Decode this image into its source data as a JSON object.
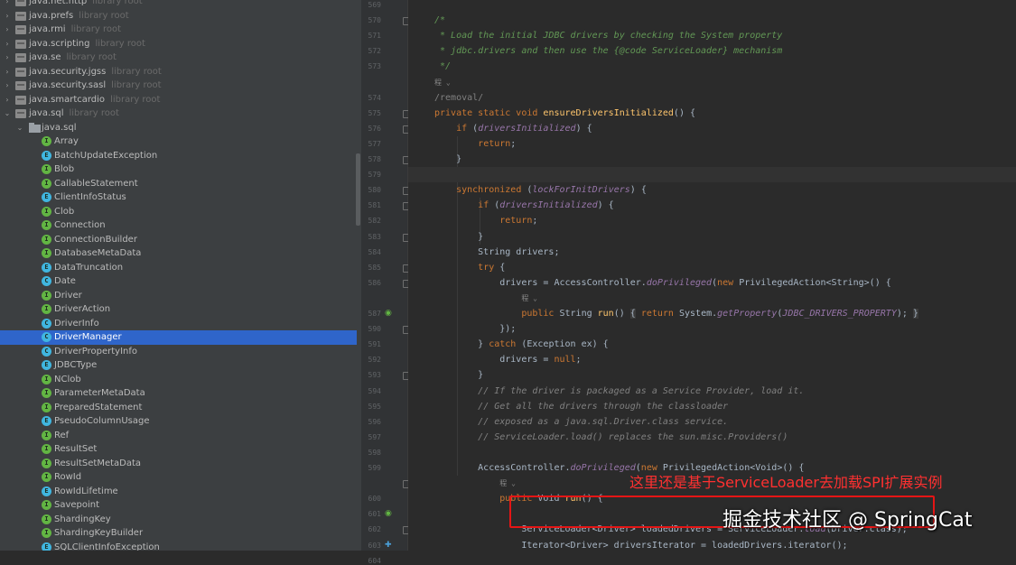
{
  "tree": {
    "items": [
      {
        "label": "java.net.http",
        "root": "library root",
        "kind": "jar"
      },
      {
        "label": "java.prefs",
        "root": "library root",
        "kind": "jar"
      },
      {
        "label": "java.rmi",
        "root": "library root",
        "kind": "jar"
      },
      {
        "label": "java.scripting",
        "root": "library root",
        "kind": "jar"
      },
      {
        "label": "java.se",
        "root": "library root",
        "kind": "jar"
      },
      {
        "label": "java.security.jgss",
        "root": "library root",
        "kind": "jar"
      },
      {
        "label": "java.security.sasl",
        "root": "library root",
        "kind": "jar"
      },
      {
        "label": "java.smartcardio",
        "root": "library root",
        "kind": "jar"
      },
      {
        "label": "java.sql",
        "root": "library root",
        "kind": "jar-open"
      },
      {
        "label": "java.sql",
        "root": "",
        "kind": "package"
      },
      {
        "label": "Array",
        "root": "",
        "kind": "I"
      },
      {
        "label": "BatchUpdateException",
        "root": "",
        "kind": "E"
      },
      {
        "label": "Blob",
        "root": "",
        "kind": "I"
      },
      {
        "label": "CallableStatement",
        "root": "",
        "kind": "I"
      },
      {
        "label": "ClientInfoStatus",
        "root": "",
        "kind": "E"
      },
      {
        "label": "Clob",
        "root": "",
        "kind": "I"
      },
      {
        "label": "Connection",
        "root": "",
        "kind": "I"
      },
      {
        "label": "ConnectionBuilder",
        "root": "",
        "kind": "I"
      },
      {
        "label": "DatabaseMetaData",
        "root": "",
        "kind": "I"
      },
      {
        "label": "DataTruncation",
        "root": "",
        "kind": "E"
      },
      {
        "label": "Date",
        "root": "",
        "kind": "C"
      },
      {
        "label": "Driver",
        "root": "",
        "kind": "I"
      },
      {
        "label": "DriverAction",
        "root": "",
        "kind": "I"
      },
      {
        "label": "DriverInfo",
        "root": "",
        "kind": "C"
      },
      {
        "label": "DriverManager",
        "root": "",
        "kind": "C",
        "selected": true
      },
      {
        "label": "DriverPropertyInfo",
        "root": "",
        "kind": "C"
      },
      {
        "label": "JDBCType",
        "root": "",
        "kind": "E"
      },
      {
        "label": "NClob",
        "root": "",
        "kind": "I"
      },
      {
        "label": "ParameterMetaData",
        "root": "",
        "kind": "I"
      },
      {
        "label": "PreparedStatement",
        "root": "",
        "kind": "I"
      },
      {
        "label": "PseudoColumnUsage",
        "root": "",
        "kind": "E"
      },
      {
        "label": "Ref",
        "root": "",
        "kind": "I"
      },
      {
        "label": "ResultSet",
        "root": "",
        "kind": "I"
      },
      {
        "label": "ResultSetMetaData",
        "root": "",
        "kind": "I"
      },
      {
        "label": "RowId",
        "root": "",
        "kind": "I"
      },
      {
        "label": "RowIdLifetime",
        "root": "",
        "kind": "E"
      },
      {
        "label": "Savepoint",
        "root": "",
        "kind": "I"
      },
      {
        "label": "ShardingKey",
        "root": "",
        "kind": "I"
      },
      {
        "label": "ShardingKeyBuilder",
        "root": "",
        "kind": "I"
      },
      {
        "label": "SQLClientInfoException",
        "root": "",
        "kind": "E"
      }
    ]
  },
  "editor": {
    "lines": [
      {
        "no": "569",
        "segs": []
      },
      {
        "no": "570",
        "segs": [
          [
            "cm",
            "/*"
          ]
        ]
      },
      {
        "no": "571",
        "segs": [
          [
            "cm",
            " * Load the initial JDBC drivers by checking the System property"
          ]
        ]
      },
      {
        "no": "572",
        "segs": [
          [
            "cm",
            " * jdbc.drivers and then use the {@code ServiceLoader} mechanism"
          ]
        ]
      },
      {
        "no": "573",
        "segs": [
          [
            "cm",
            " */"
          ]
        ]
      },
      {
        "no": "",
        "segs": [
          [
            "small",
            "程 ⌄"
          ]
        ]
      },
      {
        "no": "574",
        "segs": [
          [
            "gray",
            "/removal/"
          ]
        ]
      },
      {
        "no": "575",
        "segs": [
          [
            "kw",
            "private static void "
          ],
          [
            "fn",
            "ensureDriversInitialized"
          ],
          [
            "",
            "() {"
          ]
        ]
      },
      {
        "no": "576",
        "segs": [
          [
            "",
            "    "
          ],
          [
            "kw",
            "if "
          ],
          [
            "",
            "("
          ],
          [
            "it",
            "driversInitialized"
          ],
          [
            "",
            ") {"
          ]
        ]
      },
      {
        "no": "577",
        "segs": [
          [
            "",
            "        "
          ],
          [
            "kw",
            "return"
          ],
          [
            "",
            ";"
          ]
        ]
      },
      {
        "no": "578",
        "segs": [
          [
            "",
            "    }"
          ]
        ]
      },
      {
        "no": "579",
        "segs": [],
        "current": true
      },
      {
        "no": "580",
        "segs": [
          [
            "",
            "    "
          ],
          [
            "kw",
            "synchronized "
          ],
          [
            "",
            "("
          ],
          [
            "it",
            "lockForInitDrivers"
          ],
          [
            "",
            ") {"
          ]
        ]
      },
      {
        "no": "581",
        "segs": [
          [
            "",
            "        "
          ],
          [
            "kw",
            "if "
          ],
          [
            "",
            "("
          ],
          [
            "it",
            "driversInitialized"
          ],
          [
            "",
            ") {"
          ]
        ]
      },
      {
        "no": "582",
        "segs": [
          [
            "",
            "            "
          ],
          [
            "kw",
            "return"
          ],
          [
            "",
            ";"
          ]
        ]
      },
      {
        "no": "583",
        "segs": [
          [
            "",
            "        }"
          ]
        ]
      },
      {
        "no": "584",
        "segs": [
          [
            "",
            "        String drivers;"
          ]
        ]
      },
      {
        "no": "585",
        "segs": [
          [
            "",
            "        "
          ],
          [
            "kw",
            "try "
          ],
          [
            "",
            "{"
          ]
        ]
      },
      {
        "no": "586",
        "segs": [
          [
            "",
            "            drivers = AccessController."
          ],
          [
            "it",
            "doPrivileged"
          ],
          [
            "",
            "("
          ],
          [
            "kw",
            "new "
          ],
          [
            "",
            "PrivilegedAction<String>() {"
          ]
        ]
      },
      {
        "no": "",
        "segs": [
          [
            "",
            "                "
          ],
          [
            "small",
            "程 ⌄"
          ]
        ]
      },
      {
        "no": "587",
        "segs": [
          [
            "",
            "                "
          ],
          [
            "kw",
            "public "
          ],
          [
            "",
            "String "
          ],
          [
            "fn",
            "run"
          ],
          [
            "",
            "() "
          ],
          [
            "yb",
            "{"
          ],
          [
            "",
            " "
          ],
          [
            "kw",
            "return "
          ],
          [
            "",
            "System."
          ],
          [
            "it",
            "getProperty"
          ],
          [
            "",
            "("
          ],
          [
            "cc",
            "JDBC_DRIVERS_PROPERTY"
          ],
          [
            "",
            "); "
          ],
          [
            "yb",
            "}"
          ]
        ]
      },
      {
        "no": "590",
        "segs": [
          [
            "",
            "            });"
          ]
        ]
      },
      {
        "no": "591",
        "segs": [
          [
            "",
            "        } "
          ],
          [
            "kw",
            "catch "
          ],
          [
            "",
            "(Exception ex) {"
          ]
        ]
      },
      {
        "no": "592",
        "segs": [
          [
            "",
            "            drivers = "
          ],
          [
            "kw",
            "null"
          ],
          [
            "",
            ";"
          ]
        ]
      },
      {
        "no": "593",
        "segs": [
          [
            "",
            "        }"
          ]
        ]
      },
      {
        "no": "594",
        "segs": [
          [
            "",
            "        "
          ],
          [
            "lc",
            "// If the driver is packaged as a Service Provider, load it."
          ]
        ]
      },
      {
        "no": "595",
        "segs": [
          [
            "",
            "        "
          ],
          [
            "lc",
            "// Get all the drivers through the classloader"
          ]
        ]
      },
      {
        "no": "596",
        "segs": [
          [
            "",
            "        "
          ],
          [
            "lc",
            "// exposed as a java.sql.Driver.class service."
          ]
        ]
      },
      {
        "no": "597",
        "segs": [
          [
            "",
            "        "
          ],
          [
            "lc",
            "// ServiceLoader.load() replaces the sun.misc.Providers()"
          ]
        ]
      },
      {
        "no": "598",
        "segs": []
      },
      {
        "no": "599",
        "segs": [
          [
            "",
            "        AccessController."
          ],
          [
            "it",
            "doPrivileged"
          ],
          [
            "",
            "("
          ],
          [
            "kw",
            "new "
          ],
          [
            "",
            "PrivilegedAction<Void>() {"
          ]
        ]
      },
      {
        "no": "",
        "segs": [
          [
            "",
            "            "
          ],
          [
            "small",
            "程 ⌄"
          ]
        ]
      },
      {
        "no": "600",
        "segs": [
          [
            "",
            "            "
          ],
          [
            "kw",
            "public "
          ],
          [
            "",
            "Void "
          ],
          [
            "fn",
            "run"
          ],
          [
            "",
            "() {"
          ]
        ]
      },
      {
        "no": "601",
        "segs": []
      },
      {
        "no": "602",
        "segs": [
          [
            "",
            "                ServiceLoader<Driver> loadedDrivers = ServiceLoader."
          ],
          [
            "it",
            "load"
          ],
          [
            "",
            "(Driver.class);"
          ]
        ]
      },
      {
        "no": "603",
        "segs": [
          [
            "",
            "                Iterator<Driver> driversIterator = loadedDrivers.iterator();"
          ]
        ]
      },
      {
        "no": "604",
        "segs": []
      }
    ]
  },
  "annotation": "这里还是基于ServiceLoader去加载SPI扩展实例",
  "watermark": "掘金技术社区 @ SpringCat",
  "colors": {
    "selection": "#2f65ca",
    "annotation": "#ff3030",
    "box": "#e51515",
    "comment": "#629755",
    "keyword": "#cc7832"
  }
}
